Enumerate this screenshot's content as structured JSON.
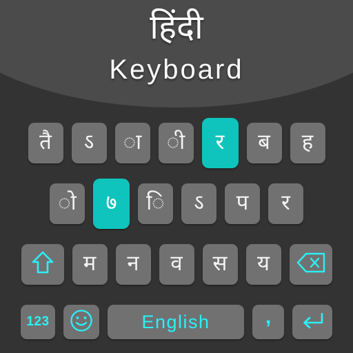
{
  "app": {
    "title_native": "हिंदी",
    "title_latin": "Keyboard",
    "background_color": "#333333",
    "header_arc_color": "#4b4b4b",
    "key_color": "#717171",
    "accent_color": "#0fc4bd",
    "cyan_color": "#2bf0f5",
    "key_text_color": "#f4f4f4"
  },
  "keyboard": {
    "rows": [
      {
        "name": "row-1",
        "keys": [
          {
            "label": "तै",
            "type": "letter",
            "highlighted": false,
            "name": "key-tai"
          },
          {
            "label": "ऽ",
            "type": "letter",
            "highlighted": false,
            "name": "key-avagraha"
          },
          {
            "label": "ा",
            "type": "letter",
            "highlighted": false,
            "name": "key-aa-matra"
          },
          {
            "label": "ी",
            "type": "letter",
            "highlighted": false,
            "name": "key-ii-matra"
          },
          {
            "label": "र",
            "type": "letter",
            "highlighted": true,
            "name": "key-ra"
          },
          {
            "label": "ब",
            "type": "letter",
            "highlighted": false,
            "name": "key-ba"
          },
          {
            "label": "ह",
            "type": "letter",
            "highlighted": false,
            "name": "key-ha"
          }
        ]
      },
      {
        "name": "row-2",
        "keys": [
          {
            "label": "ो",
            "type": "letter",
            "highlighted": false,
            "name": "key-o-matra"
          },
          {
            "label": "७",
            "type": "letter",
            "highlighted": true,
            "name": "key-seven"
          },
          {
            "label": "ि",
            "type": "letter",
            "highlighted": false,
            "name": "key-i-matra"
          },
          {
            "label": "ऽ",
            "type": "letter",
            "highlighted": false,
            "name": "key-avagraha-2"
          },
          {
            "label": "प",
            "type": "letter",
            "highlighted": false,
            "name": "key-pa"
          },
          {
            "label": "र",
            "type": "letter",
            "highlighted": false,
            "name": "key-ra-2"
          }
        ]
      },
      {
        "name": "row-3",
        "keys": [
          {
            "label": "",
            "type": "shift",
            "icon": "shift-arrow-up-icon",
            "highlighted": false,
            "name": "key-shift"
          },
          {
            "label": "म",
            "type": "letter",
            "highlighted": false,
            "name": "key-ma"
          },
          {
            "label": "न",
            "type": "letter",
            "highlighted": false,
            "name": "key-na"
          },
          {
            "label": "व",
            "type": "letter",
            "highlighted": false,
            "name": "key-va"
          },
          {
            "label": "स",
            "type": "letter",
            "highlighted": false,
            "name": "key-sa"
          },
          {
            "label": "य",
            "type": "letter",
            "highlighted": false,
            "name": "key-ya"
          },
          {
            "label": "",
            "type": "backspace",
            "icon": "backspace-delete-icon",
            "highlighted": false,
            "name": "key-backspace"
          }
        ]
      },
      {
        "name": "row-4",
        "keys": [
          {
            "label": "123",
            "type": "numeric",
            "highlighted": false,
            "name": "key-numeric-switch"
          },
          {
            "label": "",
            "type": "emoji",
            "icon": "smiley-face-icon",
            "highlighted": false,
            "name": "key-emoji"
          },
          {
            "label": "English",
            "type": "space",
            "highlighted": false,
            "name": "key-spacebar"
          },
          {
            "label": ",",
            "type": "comma",
            "highlighted": false,
            "name": "key-comma"
          },
          {
            "label": "",
            "type": "enter",
            "icon": "enter-return-arrow-icon",
            "highlighted": false,
            "name": "key-enter"
          }
        ]
      }
    ]
  }
}
